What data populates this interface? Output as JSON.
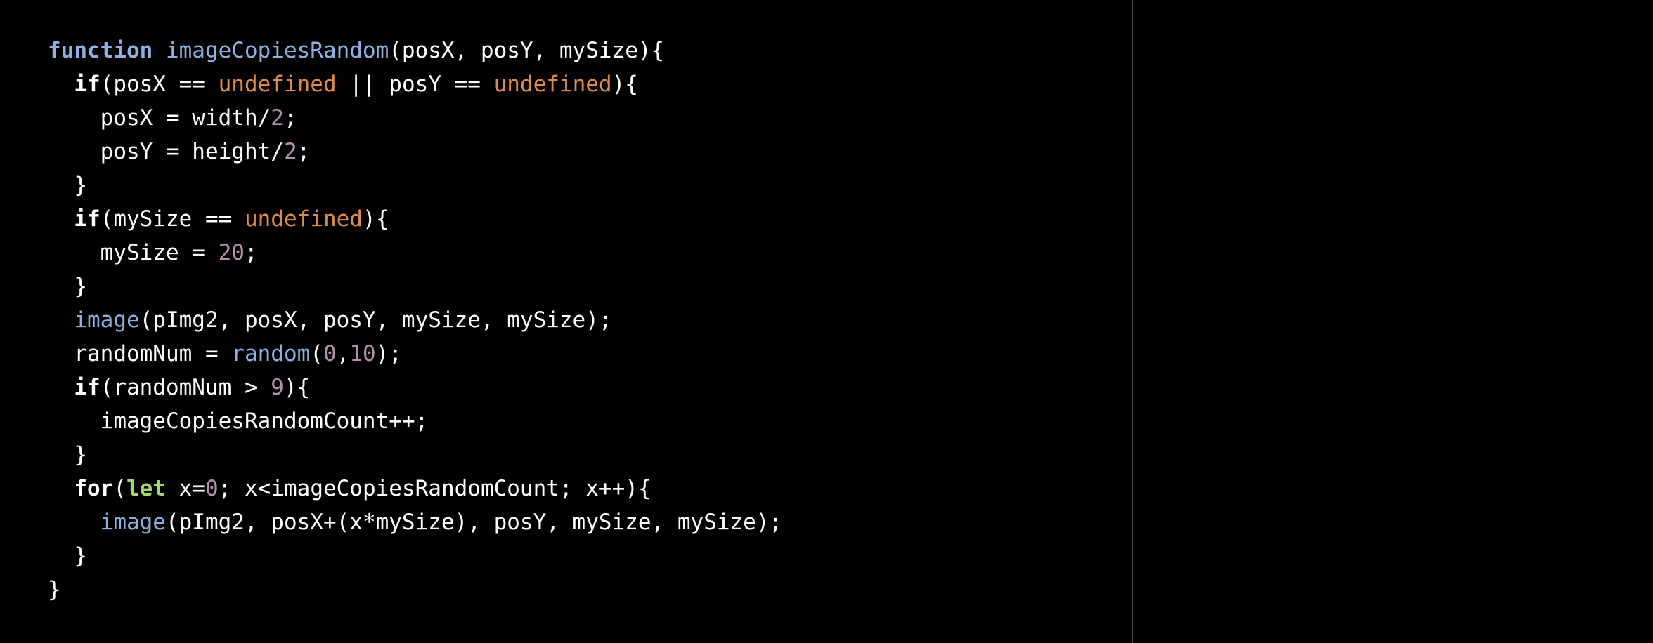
{
  "colors": {
    "background": "#000000",
    "divider": "#4a4a4a",
    "text": "#ffffff",
    "keyword": "#ffffff",
    "declaration": "#8fb0e0",
    "function_call": "#8fb0e0",
    "undefined": "#e08a4a",
    "number": "#b48ead",
    "let": "#a6d96a"
  },
  "code": {
    "lines": [
      [
        {
          "t": "function",
          "k": "decl"
        },
        {
          "t": " ",
          "k": "plain"
        },
        {
          "t": "imageCopiesRandom",
          "k": "fn"
        },
        {
          "t": "(posX, posY, mySize){",
          "k": "plain"
        }
      ],
      [
        {
          "t": "  ",
          "k": "plain"
        },
        {
          "t": "if",
          "k": "keyword"
        },
        {
          "t": "(posX == ",
          "k": "plain"
        },
        {
          "t": "undefined",
          "k": "undefined"
        },
        {
          "t": " || posY == ",
          "k": "plain"
        },
        {
          "t": "undefined",
          "k": "undefined"
        },
        {
          "t": "){",
          "k": "plain"
        }
      ],
      [
        {
          "t": "    posX = width/",
          "k": "plain"
        },
        {
          "t": "2",
          "k": "number"
        },
        {
          "t": ";",
          "k": "plain"
        }
      ],
      [
        {
          "t": "    posY = height/",
          "k": "plain"
        },
        {
          "t": "2",
          "k": "number"
        },
        {
          "t": ";",
          "k": "plain"
        }
      ],
      [
        {
          "t": "  }",
          "k": "plain"
        }
      ],
      [
        {
          "t": "  ",
          "k": "plain"
        },
        {
          "t": "if",
          "k": "keyword"
        },
        {
          "t": "(mySize == ",
          "k": "plain"
        },
        {
          "t": "undefined",
          "k": "undefined"
        },
        {
          "t": "){",
          "k": "plain"
        }
      ],
      [
        {
          "t": "    mySize = ",
          "k": "plain"
        },
        {
          "t": "20",
          "k": "number"
        },
        {
          "t": ";",
          "k": "plain"
        }
      ],
      [
        {
          "t": "  }",
          "k": "plain"
        }
      ],
      [
        {
          "t": "  ",
          "k": "plain"
        },
        {
          "t": "image",
          "k": "fn"
        },
        {
          "t": "(pImg2, posX, posY, mySize, mySize);",
          "k": "plain"
        }
      ],
      [
        {
          "t": "  randomNum = ",
          "k": "plain"
        },
        {
          "t": "random",
          "k": "fn"
        },
        {
          "t": "(",
          "k": "plain"
        },
        {
          "t": "0",
          "k": "number"
        },
        {
          "t": ",",
          "k": "plain"
        },
        {
          "t": "10",
          "k": "number"
        },
        {
          "t": ");",
          "k": "plain"
        }
      ],
      [
        {
          "t": "  ",
          "k": "plain"
        },
        {
          "t": "if",
          "k": "keyword"
        },
        {
          "t": "(randomNum > ",
          "k": "plain"
        },
        {
          "t": "9",
          "k": "number"
        },
        {
          "t": "){",
          "k": "plain"
        }
      ],
      [
        {
          "t": "    imageCopiesRandomCount++;",
          "k": "plain"
        }
      ],
      [
        {
          "t": "  }",
          "k": "plain"
        }
      ],
      [
        {
          "t": "  ",
          "k": "plain"
        },
        {
          "t": "for",
          "k": "keyword"
        },
        {
          "t": "(",
          "k": "plain"
        },
        {
          "t": "let",
          "k": "let"
        },
        {
          "t": " x=",
          "k": "plain"
        },
        {
          "t": "0",
          "k": "number"
        },
        {
          "t": "; x<imageCopiesRandomCount; x++){",
          "k": "plain"
        }
      ],
      [
        {
          "t": "    ",
          "k": "plain"
        },
        {
          "t": "image",
          "k": "fn"
        },
        {
          "t": "(pImg2, posX+(x*mySize), posY, mySize, mySize);",
          "k": "plain"
        }
      ],
      [
        {
          "t": "  }",
          "k": "plain"
        }
      ],
      [
        {
          "t": "}",
          "k": "plain"
        }
      ]
    ]
  }
}
